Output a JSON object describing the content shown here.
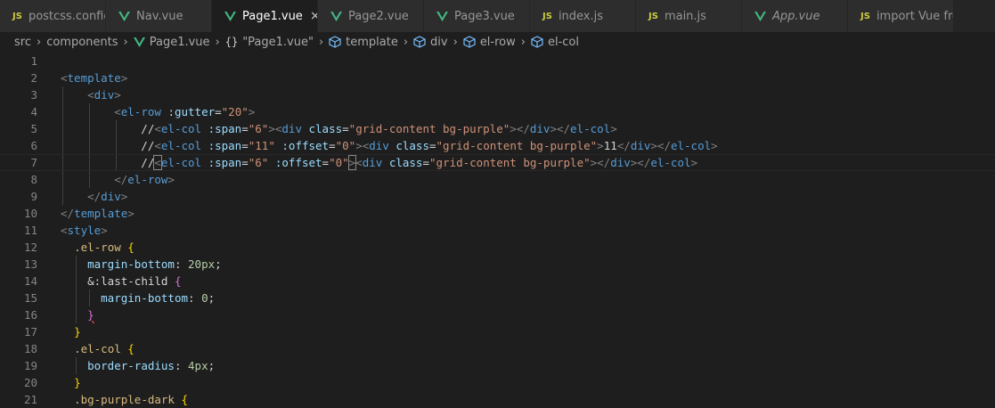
{
  "tabs": [
    {
      "icon": "js",
      "label": "postcss.config.js",
      "active": false,
      "italic": false
    },
    {
      "icon": "vue",
      "label": "Nav.vue",
      "active": false,
      "italic": false
    },
    {
      "icon": "vue",
      "label": "Page1.vue",
      "active": true,
      "italic": false
    },
    {
      "icon": "vue",
      "label": "Page2.vue",
      "active": false,
      "italic": false
    },
    {
      "icon": "vue",
      "label": "Page3.vue",
      "active": false,
      "italic": false
    },
    {
      "icon": "js",
      "label": "index.js",
      "active": false,
      "italic": false
    },
    {
      "icon": "js",
      "label": "main.js",
      "active": false,
      "italic": false
    },
    {
      "icon": "vue",
      "label": "App.vue",
      "active": false,
      "italic": true
    },
    {
      "icon": "js",
      "label": "import Vue from",
      "active": false,
      "italic": false
    }
  ],
  "icons": {
    "js_badge": "JS",
    "close_glyph": "×",
    "vue_color": "#42b883",
    "js_color": "#cbcb41"
  },
  "breadcrumb": {
    "src": "src",
    "components": "components",
    "file": "Page1.vue",
    "obj_glyph": "{}",
    "obj_label": "\"Page1.vue\"",
    "template": "template",
    "div": "div",
    "el_row": "el-row",
    "el_col": "el-col",
    "separator": "›"
  },
  "editor": {
    "lines": [
      {
        "n": "1",
        "segs": []
      },
      {
        "n": "2",
        "segs": [
          [
            "t-br",
            "<"
          ],
          [
            "t-tag",
            "template"
          ],
          [
            "t-br",
            ">"
          ]
        ]
      },
      {
        "n": "3",
        "segs": [
          [
            "t-text",
            "    "
          ],
          [
            "t-br",
            "<"
          ],
          [
            "t-tag",
            "div"
          ],
          [
            "t-br",
            ">"
          ]
        ]
      },
      {
        "n": "4",
        "segs": [
          [
            "t-text",
            "        "
          ],
          [
            "t-br",
            "<"
          ],
          [
            "t-tag",
            "el-row"
          ],
          [
            "t-text",
            " "
          ],
          [
            "t-attr",
            ":gutter"
          ],
          [
            "t-text",
            "="
          ],
          [
            "t-str",
            "\"20\""
          ],
          [
            "t-br",
            ">"
          ]
        ]
      },
      {
        "n": "5",
        "segs": [
          [
            "t-text",
            "            //"
          ],
          [
            "t-br",
            "<"
          ],
          [
            "t-tag",
            "el-col"
          ],
          [
            "t-text",
            " "
          ],
          [
            "t-attr",
            ":span"
          ],
          [
            "t-text",
            "="
          ],
          [
            "t-str",
            "\"6\""
          ],
          [
            "t-br",
            "><"
          ],
          [
            "t-tag",
            "div"
          ],
          [
            "t-text",
            " "
          ],
          [
            "t-attr",
            "class"
          ],
          [
            "t-text",
            "="
          ],
          [
            "t-str",
            "\"grid-content bg-purple\""
          ],
          [
            "t-br",
            "></"
          ],
          [
            "t-tag",
            "div"
          ],
          [
            "t-br",
            "></"
          ],
          [
            "t-tag",
            "el-col"
          ],
          [
            "t-br",
            ">"
          ]
        ]
      },
      {
        "n": "6",
        "segs": [
          [
            "t-text",
            "            //"
          ],
          [
            "t-br",
            "<"
          ],
          [
            "t-tag",
            "el-col"
          ],
          [
            "t-text",
            " "
          ],
          [
            "t-attr",
            ":span"
          ],
          [
            "t-text",
            "="
          ],
          [
            "t-str",
            "\"11\""
          ],
          [
            "t-text",
            " "
          ],
          [
            "t-attr",
            ":offset"
          ],
          [
            "t-text",
            "="
          ],
          [
            "t-str",
            "\"0\""
          ],
          [
            "t-br",
            "><"
          ],
          [
            "t-tag",
            "div"
          ],
          [
            "t-text",
            " "
          ],
          [
            "t-attr",
            "class"
          ],
          [
            "t-text",
            "="
          ],
          [
            "t-str",
            "\"grid-content bg-purple\""
          ],
          [
            "t-br",
            ">"
          ],
          [
            "t-text",
            "11"
          ],
          [
            "t-br",
            "</"
          ],
          [
            "t-tag",
            "div"
          ],
          [
            "t-br",
            "></"
          ],
          [
            "t-tag",
            "el-col"
          ],
          [
            "t-br",
            ">"
          ]
        ]
      },
      {
        "n": "7",
        "current": true,
        "segs": [
          [
            "t-text",
            "            //"
          ],
          [
            "t-br cursor-box",
            "<"
          ],
          [
            "t-tag",
            "el-col"
          ],
          [
            "t-text",
            " "
          ],
          [
            "t-attr",
            ":span"
          ],
          [
            "t-text",
            "="
          ],
          [
            "t-str",
            "\"6\""
          ],
          [
            "t-text",
            " "
          ],
          [
            "t-attr",
            ":offset"
          ],
          [
            "t-text",
            "="
          ],
          [
            "t-str",
            "\"0\""
          ],
          [
            "t-br cursor-box",
            ">"
          ],
          [
            "t-br",
            "<"
          ],
          [
            "t-tag",
            "div"
          ],
          [
            "t-text",
            " "
          ],
          [
            "t-attr",
            "class"
          ],
          [
            "t-text",
            "="
          ],
          [
            "t-str",
            "\"grid-content bg-purple\""
          ],
          [
            "t-br",
            "></"
          ],
          [
            "t-tag",
            "div"
          ],
          [
            "t-br",
            "></"
          ],
          [
            "t-tag",
            "el-col"
          ],
          [
            "t-br",
            ">"
          ]
        ]
      },
      {
        "n": "8",
        "segs": [
          [
            "t-text",
            "        "
          ],
          [
            "t-br",
            "</"
          ],
          [
            "t-tag",
            "el-row"
          ],
          [
            "t-br",
            ">"
          ]
        ]
      },
      {
        "n": "9",
        "segs": [
          [
            "t-text",
            "    "
          ],
          [
            "t-br",
            "</"
          ],
          [
            "t-tag",
            "div"
          ],
          [
            "t-br",
            ">"
          ]
        ]
      },
      {
        "n": "10",
        "segs": [
          [
            "t-br",
            "</"
          ],
          [
            "t-tag",
            "template"
          ],
          [
            "t-br",
            ">"
          ]
        ]
      },
      {
        "n": "11",
        "segs": [
          [
            "t-br",
            "<"
          ],
          [
            "t-tag",
            "style"
          ],
          [
            "t-br",
            ">"
          ]
        ]
      },
      {
        "n": "12",
        "segs": [
          [
            "t-text",
            "  "
          ],
          [
            "t-sel",
            ".el-row"
          ],
          [
            "t-text",
            " "
          ],
          [
            "t-y",
            "{"
          ]
        ]
      },
      {
        "n": "13",
        "segs": [
          [
            "t-text",
            "    "
          ],
          [
            "t-prop",
            "margin-bottom"
          ],
          [
            "t-text",
            ": "
          ],
          [
            "t-num",
            "20px"
          ],
          [
            "t-text",
            ";"
          ]
        ]
      },
      {
        "n": "14",
        "segs": [
          [
            "t-text",
            "    "
          ],
          [
            "t-text",
            "&:last-child"
          ],
          [
            "t-text",
            " "
          ],
          [
            "t-p",
            "{"
          ]
        ]
      },
      {
        "n": "15",
        "segs": [
          [
            "t-text",
            "      "
          ],
          [
            "t-prop",
            "margin-bottom"
          ],
          [
            "t-text",
            ": "
          ],
          [
            "t-num",
            "0"
          ],
          [
            "t-text",
            ";"
          ]
        ]
      },
      {
        "n": "16",
        "segs": [
          [
            "t-text",
            "    "
          ],
          [
            "t-p squig",
            "}"
          ]
        ]
      },
      {
        "n": "17",
        "segs": [
          [
            "t-text",
            "  "
          ],
          [
            "t-y",
            "}"
          ]
        ]
      },
      {
        "n": "18",
        "segs": [
          [
            "t-text",
            "  "
          ],
          [
            "t-sel",
            ".el-col"
          ],
          [
            "t-text",
            " "
          ],
          [
            "t-y",
            "{"
          ]
        ]
      },
      {
        "n": "19",
        "segs": [
          [
            "t-text",
            "    "
          ],
          [
            "t-prop",
            "border-radius"
          ],
          [
            "t-text",
            ": "
          ],
          [
            "t-num",
            "4px"
          ],
          [
            "t-text",
            ";"
          ]
        ]
      },
      {
        "n": "20",
        "segs": [
          [
            "t-text",
            "  "
          ],
          [
            "t-y",
            "}"
          ]
        ]
      },
      {
        "n": "21",
        "segs": [
          [
            "t-text",
            "  "
          ],
          [
            "t-sel",
            ".bg-purple-dark"
          ],
          [
            "t-text",
            " "
          ],
          [
            "t-y",
            "{"
          ]
        ]
      }
    ]
  }
}
